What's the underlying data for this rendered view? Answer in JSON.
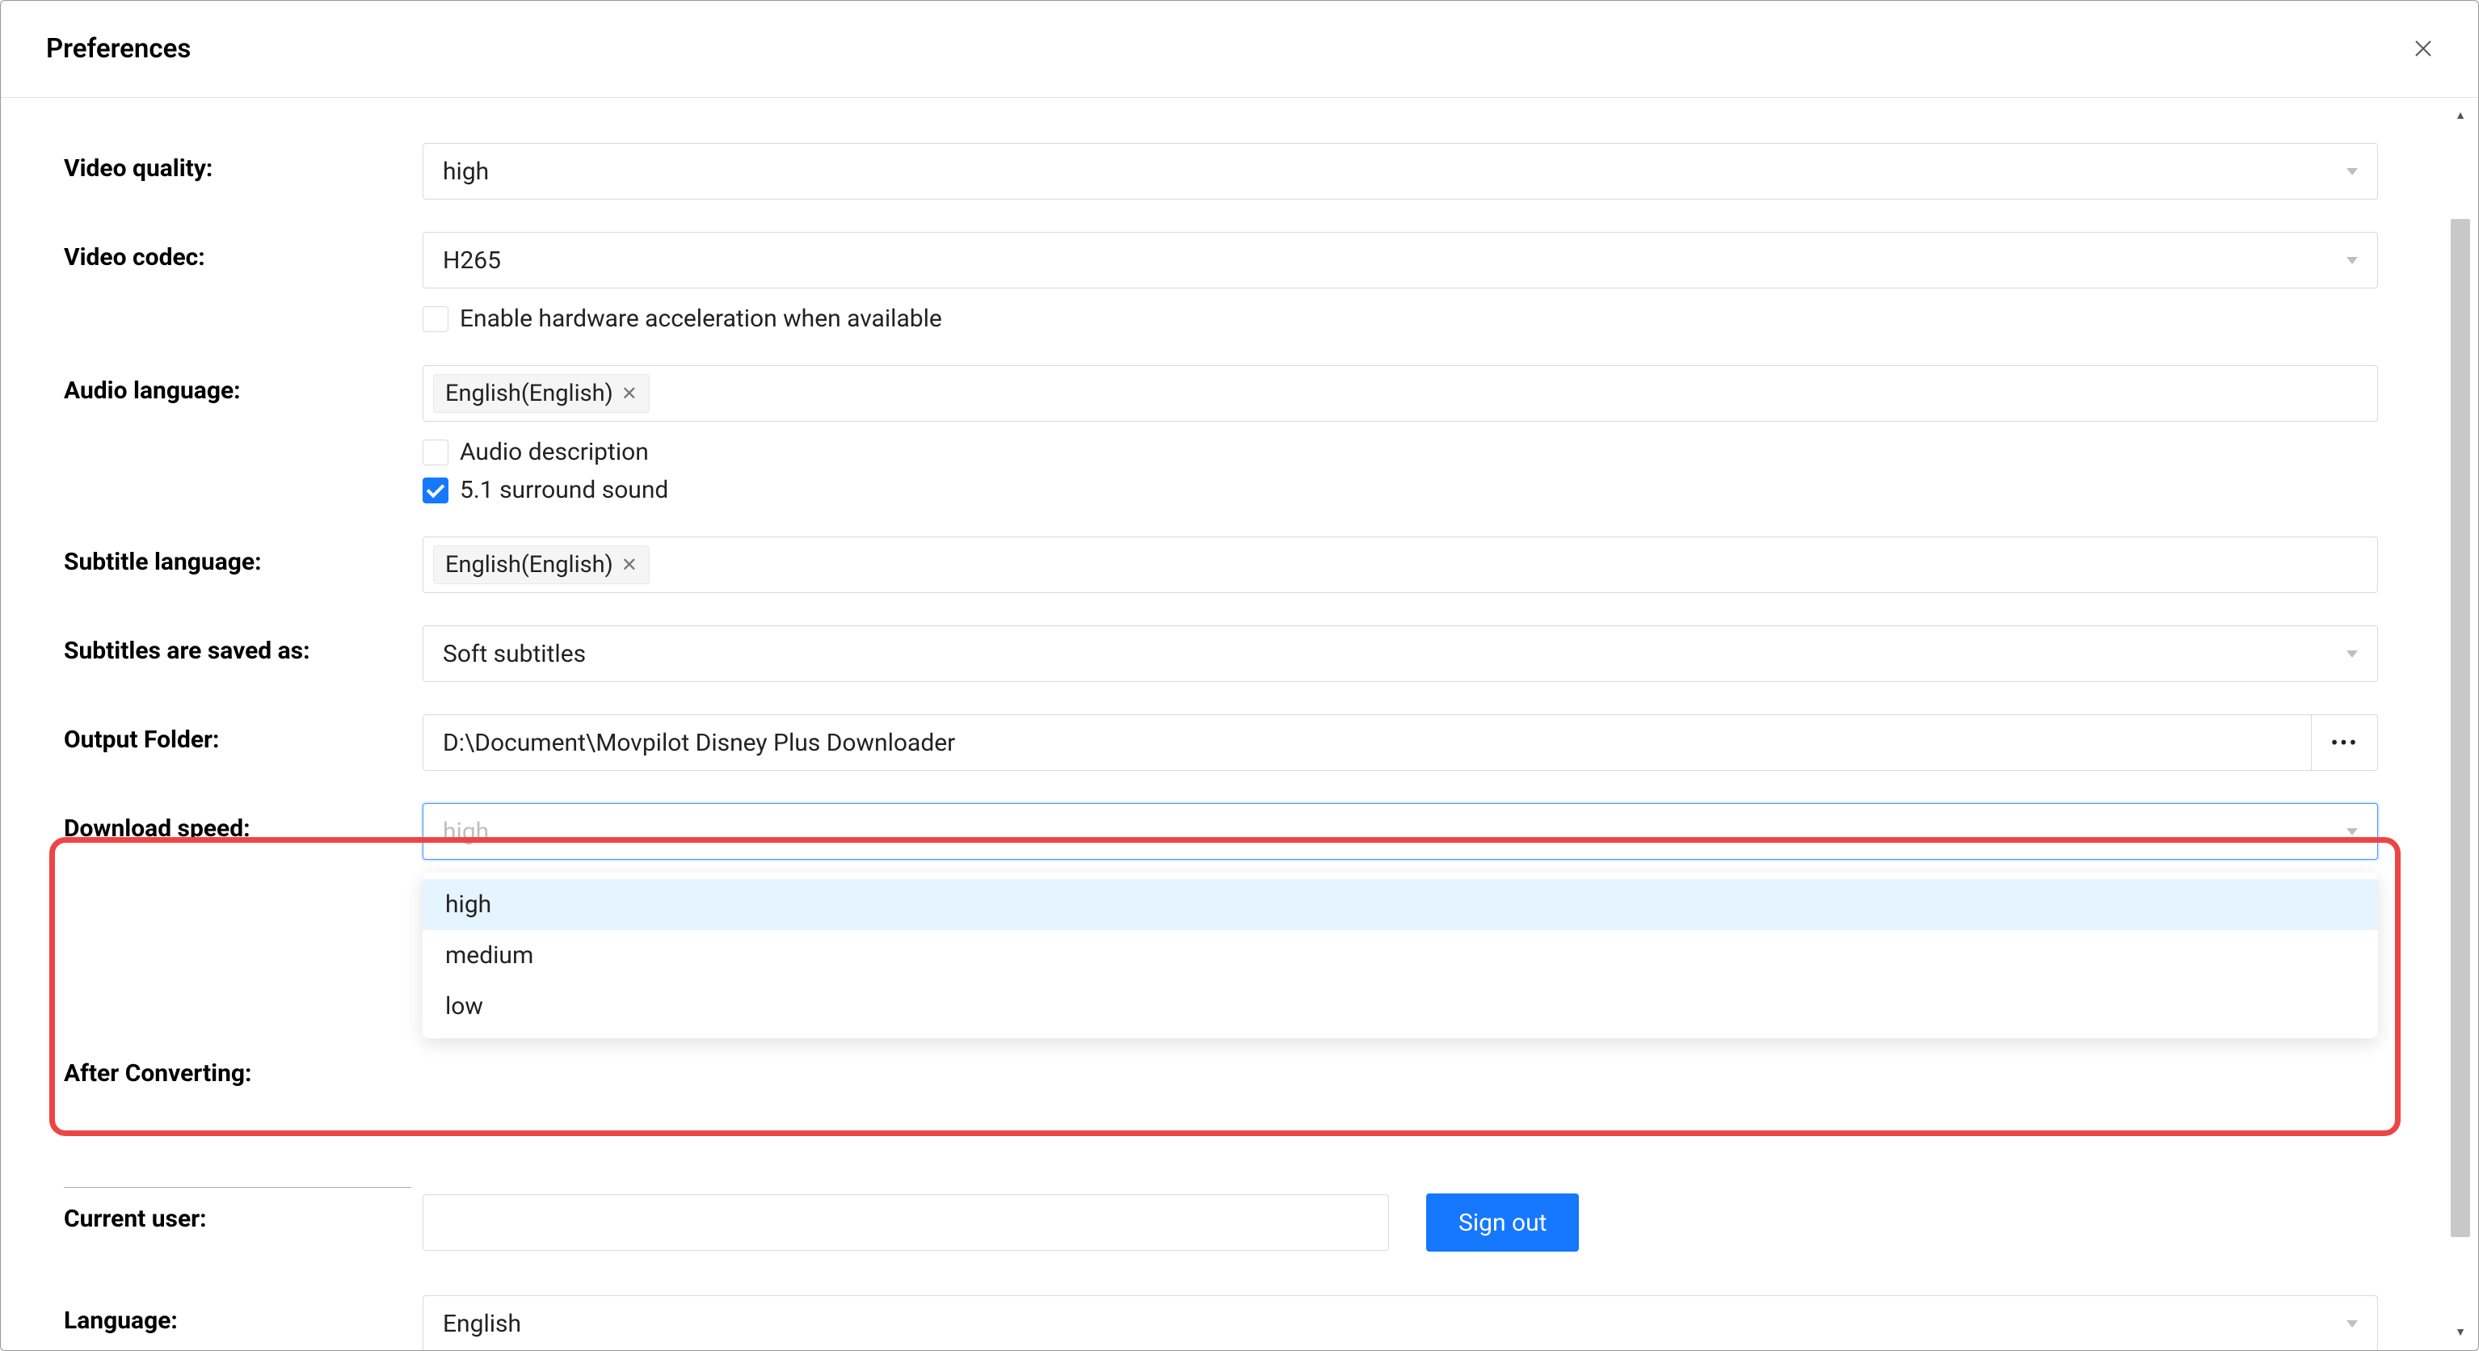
{
  "title": "Preferences",
  "fields": {
    "videoQuality": {
      "label": "Video quality:",
      "value": "high"
    },
    "videoCodec": {
      "label": "Video codec:",
      "value": "H265",
      "hwAccel": "Enable hardware acceleration when available"
    },
    "audioLang": {
      "label": "Audio language:",
      "tag": "English(English)",
      "audioDesc": "Audio description",
      "surround": "5.1 surround sound"
    },
    "subLang": {
      "label": "Subtitle language:",
      "tag": "English(English)"
    },
    "subSave": {
      "label": "Subtitles are saved as:",
      "value": "Soft subtitles"
    },
    "outputFolder": {
      "label": "Output Folder:",
      "value": "D:\\Document\\Movpilot Disney Plus Downloader"
    },
    "downloadSpeed": {
      "label": "Download speed:",
      "placeholder": "high",
      "options": [
        "high",
        "medium",
        "low"
      ]
    },
    "afterConv": {
      "label": "After Converting:"
    },
    "currentUser": {
      "label": "Current user:",
      "signOut": "Sign out"
    },
    "language": {
      "label": "Language:",
      "value": "English"
    }
  },
  "browseDots": "•••"
}
